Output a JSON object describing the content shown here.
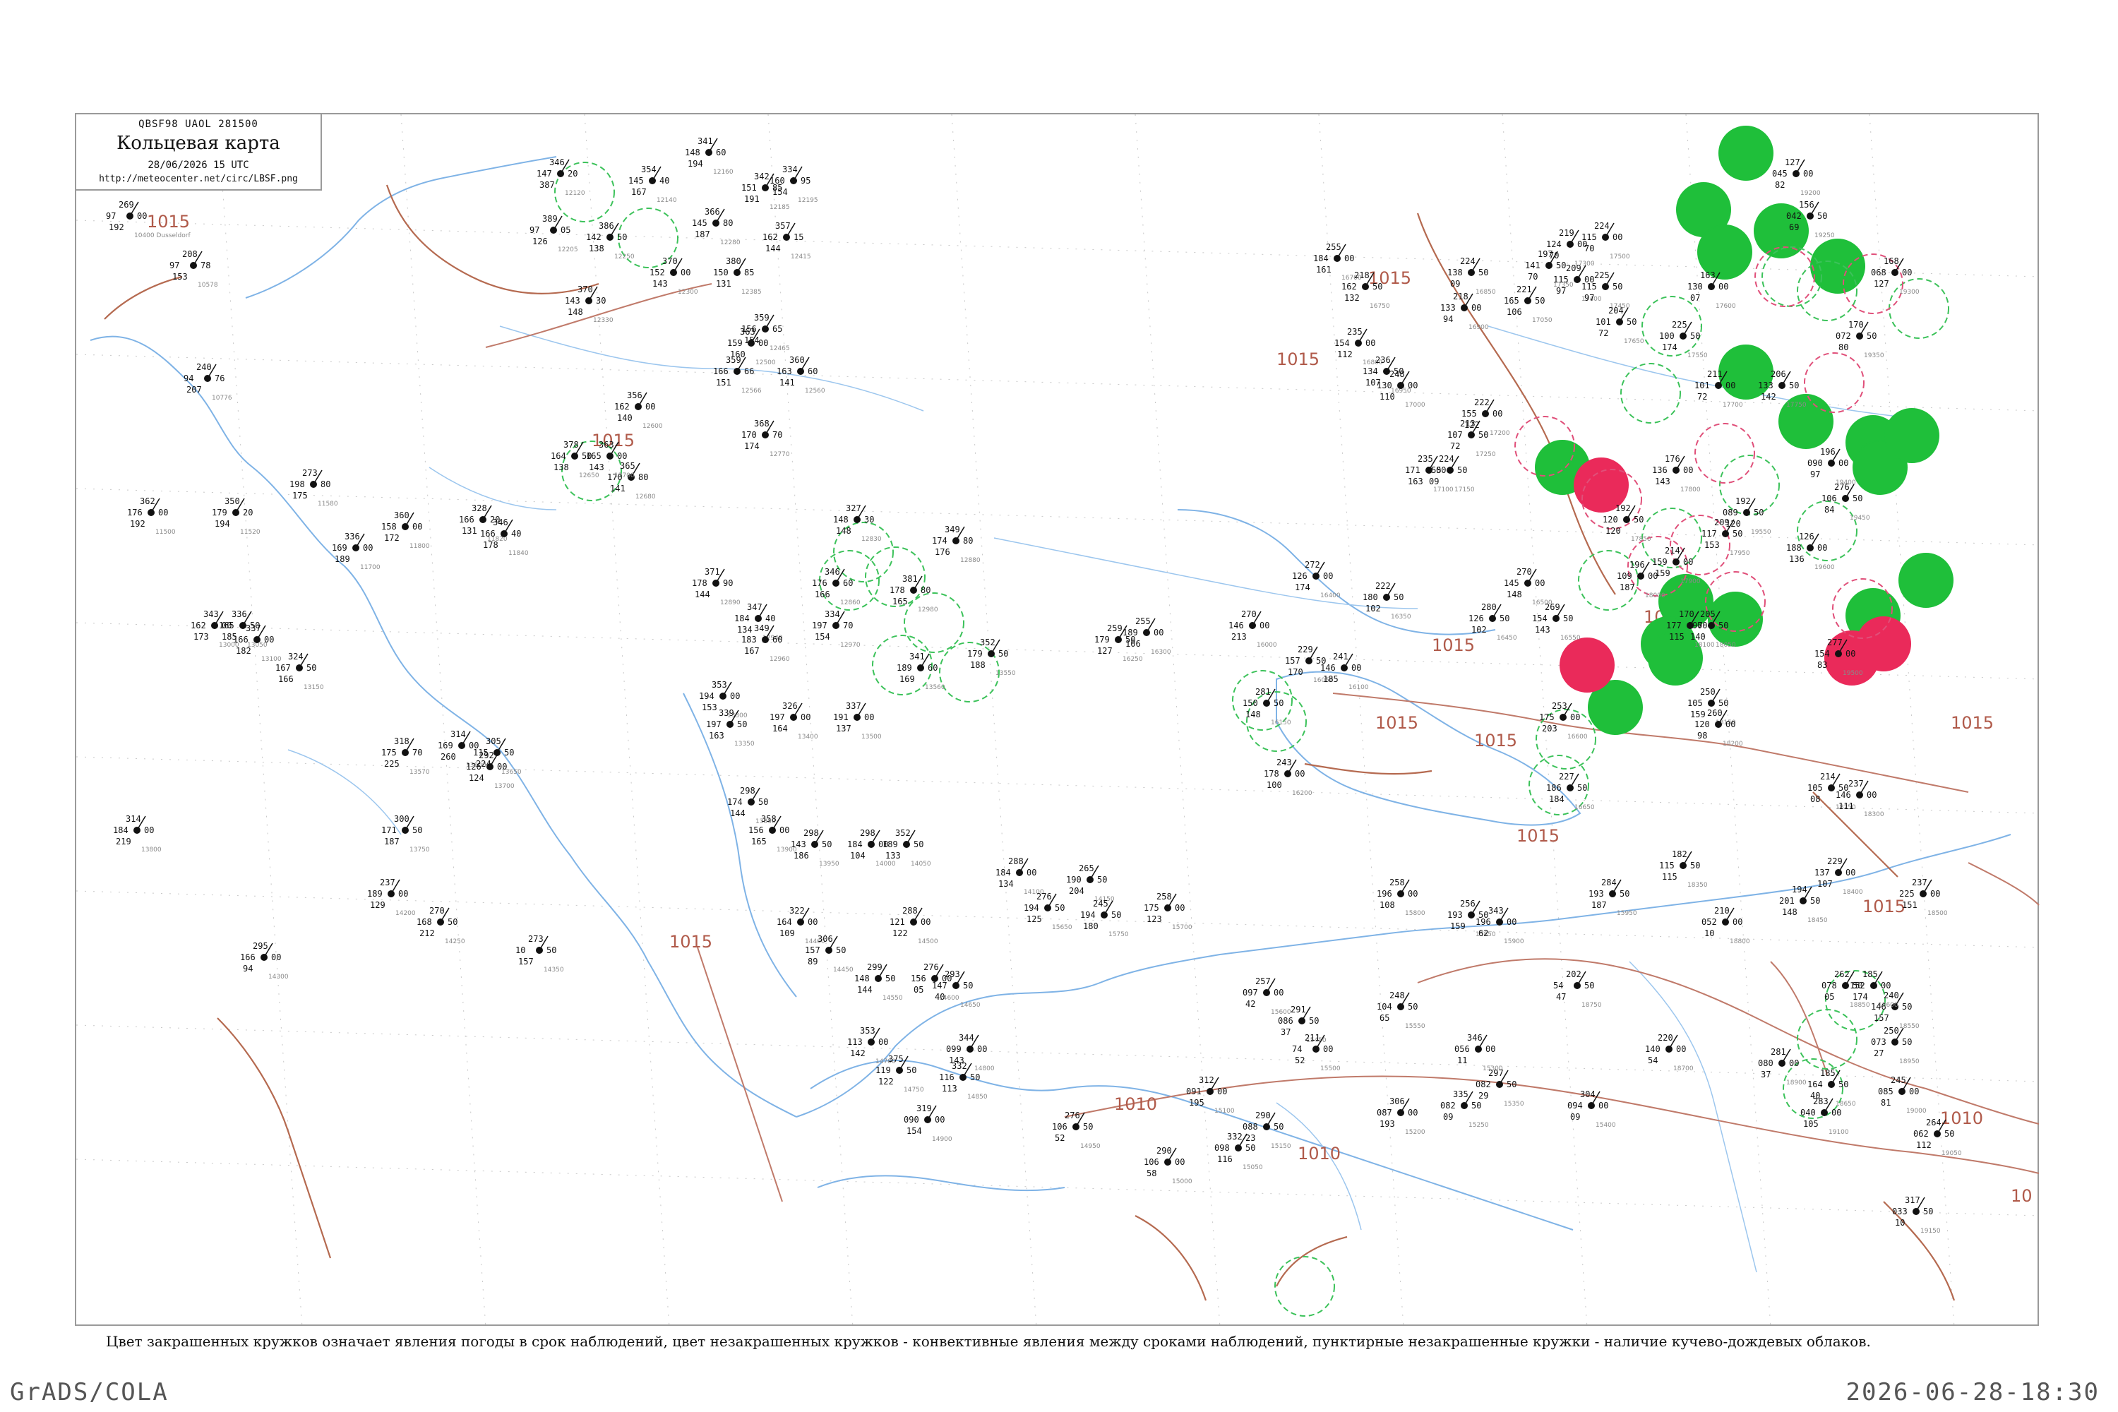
{
  "header": {
    "code": "QBSF98  UAOL  281500",
    "title": "Кольцевая карта",
    "date": "28/06/2026 15 UTC",
    "url": "http://meteocenter.net/circ/LBSF.png"
  },
  "caption": "Цвет закрашенных кружков означает явления погоды в срок наблюдений, цвет незакрашенных кружков - конвективные явления между сроками наблюдений, пунктирные незакрашенные кружки - наличие кучево-дождевых облаков.",
  "footer": {
    "left": "GrADS/COLA",
    "right": "2026-06-28-18:30"
  },
  "colors": {
    "filled_green": "#1fbf3a",
    "filled_red": "#ea2a5a",
    "ring_green": "#3cc25a",
    "ring_red": "#e0507a",
    "isobar": "#c07a6a",
    "coast": "#7fb3e6"
  },
  "isobars": [
    {
      "label": "1015"
    },
    {
      "label": "1015"
    },
    {
      "label": "1015"
    },
    {
      "label": "1015"
    },
    {
      "label": "1015"
    },
    {
      "label": "1015"
    },
    {
      "label": "1015"
    },
    {
      "label": "1015"
    },
    {
      "label": "1015"
    },
    {
      "label": "1015"
    },
    {
      "label": "1010"
    },
    {
      "label": "1010"
    },
    {
      "label": "1010"
    },
    {
      "label": "10"
    },
    {
      "label": "1015"
    },
    {
      "label": "1015"
    }
  ],
  "stations": [
    {
      "id": "10400",
      "t": "269",
      "p": "97",
      "v": "192",
      "name": "Dusseldorf"
    },
    {
      "id": "10578",
      "t": "208",
      "p": "97",
      "v": "153"
    },
    {
      "id": "10776",
      "t": "240",
      "p": "94",
      "v": "207"
    },
    {
      "id": "12120",
      "t": "346",
      "p": "147",
      "v": "387"
    },
    {
      "id": "12205",
      "t": "389",
      "p": "97",
      "v": "126"
    },
    {
      "id": "12250",
      "t": "386",
      "p": "142",
      "v": "138"
    },
    {
      "id": "12330",
      "t": "370",
      "p": "143",
      "v": "148"
    },
    {
      "id": "12140",
      "t": "354",
      "p": "145",
      "v": "167"
    },
    {
      "id": "12160",
      "t": "341",
      "p": "148",
      "v": "194"
    },
    {
      "id": "12185",
      "t": "342",
      "p": "151",
      "v": "191"
    },
    {
      "id": "12195",
      "t": "334",
      "p": "160",
      "v": "154"
    },
    {
      "id": "12280",
      "t": "366",
      "p": "145",
      "v": "187"
    },
    {
      "id": "12300",
      "t": "370",
      "p": "152",
      "v": "143"
    },
    {
      "id": "12385",
      "t": "380",
      "p": "150",
      "v": "131"
    },
    {
      "id": "12415",
      "t": "357",
      "p": "162",
      "v": "144"
    },
    {
      "id": "12465",
      "t": "359",
      "p": "156",
      "v": "154"
    },
    {
      "id": "12500",
      "t": "363",
      "p": "159",
      "v": "160"
    },
    {
      "id": "12560",
      "t": "360",
      "p": "163",
      "v": "141"
    },
    {
      "id": "12566",
      "t": "359",
      "p": "166",
      "v": "151"
    },
    {
      "id": "12600",
      "t": "356",
      "p": "162",
      "v": "140"
    },
    {
      "id": "12650",
      "t": "378",
      "p": "164",
      "v": "138"
    },
    {
      "id": "12680",
      "t": "365",
      "p": "170",
      "v": "141"
    },
    {
      "id": "12700",
      "t": "363",
      "p": "165",
      "v": "143"
    },
    {
      "id": "12770",
      "t": "368",
      "p": "170",
      "v": "174"
    },
    {
      "id": "11500",
      "t": "362",
      "p": "176",
      "v": "192"
    },
    {
      "id": "11520",
      "t": "350",
      "p": "179",
      "v": "194"
    },
    {
      "id": "11580",
      "t": "273",
      "p": "198",
      "v": "175"
    },
    {
      "id": "11700",
      "t": "336",
      "p": "169",
      "v": "189"
    },
    {
      "id": "11800",
      "t": "360",
      "p": "158",
      "v": "172"
    },
    {
      "id": "11820",
      "t": "328",
      "p": "166",
      "v": "131"
    },
    {
      "id": "11840",
      "t": "346",
      "p": "166",
      "v": "178"
    },
    {
      "id": "12830",
      "t": "327",
      "p": "148",
      "v": "148"
    },
    {
      "id": "12860",
      "t": "346",
      "p": "176",
      "v": "166"
    },
    {
      "id": "12880",
      "t": "349",
      "p": "174",
      "v": "176"
    },
    {
      "id": "12890",
      "t": "371",
      "p": "178",
      "v": "144"
    },
    {
      "id": "12940",
      "t": "347",
      "p": "184",
      "v": "134"
    },
    {
      "id": "12960",
      "t": "349",
      "p": "183",
      "v": "167"
    },
    {
      "id": "12970",
      "t": "334",
      "p": "197",
      "v": "154"
    },
    {
      "id": "12980",
      "t": "381",
      "p": "178",
      "v": "165"
    },
    {
      "id": "13000",
      "t": "343",
      "p": "162",
      "v": "173"
    },
    {
      "id": "13050",
      "t": "336",
      "p": "165",
      "v": "185"
    },
    {
      "id": "13100",
      "t": "337",
      "p": "166",
      "v": "182"
    },
    {
      "id": "13150",
      "t": "324",
      "p": "167",
      "v": "166"
    },
    {
      "id": "13300",
      "t": "353",
      "p": "194",
      "v": "153"
    },
    {
      "id": "13350",
      "t": "339",
      "p": "197",
      "v": "163"
    },
    {
      "id": "13400",
      "t": "326",
      "p": "197",
      "v": "164"
    },
    {
      "id": "13500",
      "t": "337",
      "p": "191",
      "v": "137"
    },
    {
      "id": "13550",
      "t": "352",
      "p": "179",
      "v": "188"
    },
    {
      "id": "13560",
      "t": "341",
      "p": "189",
      "v": "169"
    },
    {
      "id": "13570",
      "t": "318",
      "p": "175",
      "v": "225"
    },
    {
      "id": "13600",
      "t": "314",
      "p": "169",
      "v": "260"
    },
    {
      "id": "13650",
      "t": "305",
      "p": "115",
      "v": "224"
    },
    {
      "id": "13700",
      "t": "292",
      "p": "126",
      "v": "124"
    },
    {
      "id": "13750",
      "t": "300",
      "p": "171",
      "v": "187"
    },
    {
      "id": "13800",
      "t": "314",
      "p": "184",
      "v": "219"
    },
    {
      "id": "13850",
      "t": "298",
      "p": "174",
      "v": "144"
    },
    {
      "id": "13900",
      "t": "358",
      "p": "156",
      "v": "165"
    },
    {
      "id": "13950",
      "t": "298",
      "p": "143",
      "v": "186"
    },
    {
      "id": "14000",
      "t": "298",
      "p": "184",
      "v": "104"
    },
    {
      "id": "14050",
      "t": "352",
      "p": "189",
      "v": "133"
    },
    {
      "id": "14100",
      "t": "288",
      "p": "184",
      "v": "134"
    },
    {
      "id": "14150",
      "t": "265",
      "p": "190",
      "v": "204"
    },
    {
      "id": "14200",
      "t": "237",
      "p": "189",
      "v": "129"
    },
    {
      "id": "14250",
      "t": "270",
      "p": "168",
      "v": "212"
    },
    {
      "id": "14300",
      "t": "295",
      "p": "166",
      "v": "94"
    },
    {
      "id": "14350",
      "t": "273",
      "p": "10",
      "v": "157"
    },
    {
      "id": "14400",
      "t": "322",
      "p": "164",
      "v": "109"
    },
    {
      "id": "14450",
      "t": "306",
      "p": "157",
      "v": "89"
    },
    {
      "id": "14500",
      "t": "288",
      "p": "121",
      "v": "122"
    },
    {
      "id": "14550",
      "t": "299",
      "p": "148",
      "v": "144"
    },
    {
      "id": "14600",
      "t": "276",
      "p": "156",
      "v": "05"
    },
    {
      "id": "14650",
      "t": "293",
      "p": "147",
      "v": "40"
    },
    {
      "id": "14700",
      "t": "353",
      "p": "113",
      "v": "142"
    },
    {
      "id": "14750",
      "t": "375",
      "p": "119",
      "v": "122"
    },
    {
      "id": "14800",
      "t": "344",
      "p": "099",
      "v": "143"
    },
    {
      "id": "14850",
      "t": "332",
      "p": "116",
      "v": "113"
    },
    {
      "id": "14900",
      "t": "319",
      "p": "090",
      "v": "154"
    },
    {
      "id": "14950",
      "t": "276",
      "p": "106",
      "v": "52"
    },
    {
      "id": "15000",
      "t": "290",
      "p": "106",
      "v": "58"
    },
    {
      "id": "15050",
      "t": "332",
      "p": "098",
      "v": "116"
    },
    {
      "id": "15100",
      "t": "312",
      "p": "091",
      "v": "195"
    },
    {
      "id": "15150",
      "t": "290",
      "p": "088",
      "v": "23"
    },
    {
      "id": "15200",
      "t": "306",
      "p": "087",
      "v": "193"
    },
    {
      "id": "15250",
      "t": "335",
      "p": "082",
      "v": "09"
    },
    {
      "id": "15300",
      "t": "346",
      "p": "056",
      "v": "11"
    },
    {
      "id": "15350",
      "t": "297",
      "p": "082",
      "v": "29"
    },
    {
      "id": "15400",
      "t": "304",
      "p": "094",
      "v": "09"
    },
    {
      "id": "15450",
      "t": "291",
      "p": "086",
      "v": "37"
    },
    {
      "id": "15500",
      "t": "211",
      "p": "74",
      "v": "52"
    },
    {
      "id": "15550",
      "t": "248",
      "p": "104",
      "v": "65"
    },
    {
      "id": "15600",
      "t": "257",
      "p": "097",
      "v": "42"
    },
    {
      "id": "15650",
      "t": "276",
      "p": "194",
      "v": "125"
    },
    {
      "id": "15700",
      "t": "258",
      "p": "175",
      "v": "123"
    },
    {
      "id": "15750",
      "t": "245",
      "p": "194",
      "v": "180"
    },
    {
      "id": "15800",
      "t": "258",
      "p": "196",
      "v": "108"
    },
    {
      "id": "15850",
      "t": "256",
      "p": "193",
      "v": "159"
    },
    {
      "id": "15900",
      "t": "343",
      "p": "196",
      "v": "62"
    },
    {
      "id": "15950",
      "t": "284",
      "p": "193",
      "v": "187"
    },
    {
      "id": "16000",
      "t": "270",
      "p": "146",
      "v": "213"
    },
    {
      "id": "16050",
      "t": "229",
      "p": "157",
      "v": "170"
    },
    {
      "id": "16100",
      "t": "241",
      "p": "146",
      "v": "185"
    },
    {
      "id": "16150",
      "t": "281",
      "p": "150",
      "v": "148"
    },
    {
      "id": "16200",
      "t": "243",
      "p": "178",
      "v": "100"
    },
    {
      "id": "16250",
      "t": "259",
      "p": "179",
      "v": "127"
    },
    {
      "id": "16300",
      "t": "255",
      "p": "189",
      "v": "106"
    },
    {
      "id": "16350",
      "t": "222",
      "p": "180",
      "v": "102"
    },
    {
      "id": "16400",
      "t": "272",
      "p": "126",
      "v": "174"
    },
    {
      "id": "16450",
      "t": "280",
      "p": "126",
      "v": "102"
    },
    {
      "id": "16500",
      "t": "270",
      "p": "145",
      "v": "148"
    },
    {
      "id": "16550",
      "t": "269",
      "p": "154",
      "v": "143"
    },
    {
      "id": "16600",
      "t": "253",
      "p": "175",
      "v": "203"
    },
    {
      "id": "16650",
      "t": "227",
      "p": "186",
      "v": "184"
    },
    {
      "id": "16700",
      "t": "255",
      "p": "184",
      "v": "161"
    },
    {
      "id": "16750",
      "t": "218",
      "p": "162",
      "v": "132"
    },
    {
      "id": "16800",
      "t": "235",
      "p": "154",
      "v": "112"
    },
    {
      "id": "16850",
      "t": "224",
      "p": "138",
      "v": "09"
    },
    {
      "id": "16900",
      "t": "218",
      "p": "133",
      "v": "94"
    },
    {
      "id": "16950",
      "t": "236",
      "p": "134",
      "v": "107"
    },
    {
      "id": "17000",
      "t": "248",
      "p": "130",
      "v": "110"
    },
    {
      "id": "17050",
      "t": "221",
      "p": "165",
      "v": "106"
    },
    {
      "id": "17100",
      "t": "235",
      "p": "171",
      "v": "163"
    },
    {
      "id": "17150",
      "t": "224",
      "p": "155",
      "v": "09"
    },
    {
      "id": "17200",
      "t": "222",
      "p": "155",
      "v": "122"
    },
    {
      "id": "17250",
      "t": "213",
      "p": "107",
      "v": "72"
    },
    {
      "id": "17300",
      "t": "219",
      "p": "124",
      "v": "70"
    },
    {
      "id": "17350",
      "t": "197",
      "p": "141",
      "v": "70"
    },
    {
      "id": "17400",
      "t": "209",
      "p": "115",
      "v": "97"
    },
    {
      "id": "17450",
      "t": "225",
      "p": "115",
      "v": "97"
    },
    {
      "id": "17500",
      "t": "224",
      "p": "115",
      "v": "70"
    },
    {
      "id": "17550",
      "t": "225",
      "p": "100",
      "v": "174"
    },
    {
      "id": "17600",
      "t": "163",
      "p": "130",
      "v": "07"
    },
    {
      "id": "17650",
      "t": "204",
      "p": "101",
      "v": "72"
    },
    {
      "id": "17700",
      "t": "211",
      "p": "101",
      "v": "72"
    },
    {
      "id": "17750",
      "t": "206",
      "p": "133",
      "v": "142"
    },
    {
      "id": "17800",
      "t": "176",
      "p": "136",
      "v": "143"
    },
    {
      "id": "17850",
      "t": "192",
      "p": "120",
      "v": "120"
    },
    {
      "id": "17900",
      "t": "214",
      "p": "159",
      "v": "159"
    },
    {
      "id": "17950",
      "t": "209",
      "p": "117",
      "v": "153"
    },
    {
      "id": "18000",
      "t": "196",
      "p": "109",
      "v": "187"
    },
    {
      "id": "18050",
      "t": "205",
      "p": "097",
      "v": "140"
    },
    {
      "id": "18100",
      "t": "170",
      "p": "177",
      "v": "115"
    },
    {
      "id": "18150",
      "t": "250",
      "p": "105",
      "v": "159"
    },
    {
      "id": "18200",
      "t": "260",
      "p": "120",
      "v": "98"
    },
    {
      "id": "18250",
      "t": "214",
      "p": "105",
      "v": "08"
    },
    {
      "id": "18300",
      "t": "237",
      "p": "146",
      "v": "111"
    },
    {
      "id": "18350",
      "t": "182",
      "p": "115",
      "v": "115"
    },
    {
      "id": "18400",
      "t": "229",
      "p": "137",
      "v": "107"
    },
    {
      "id": "18450",
      "t": "194",
      "p": "201",
      "v": "148"
    },
    {
      "id": "18500",
      "t": "237",
      "p": "225",
      "v": "151"
    },
    {
      "id": "18550",
      "t": "240",
      "p": "146",
      "v": "157"
    },
    {
      "id": "18600",
      "t": "185",
      "p": "152",
      "v": "174"
    },
    {
      "id": "18650",
      "t": "185",
      "p": "164",
      "v": "40"
    },
    {
      "id": "18700",
      "t": "220",
      "p": "140",
      "v": "54"
    },
    {
      "id": "18750",
      "t": "202",
      "p": "54",
      "v": "47"
    },
    {
      "id": "18800",
      "t": "210",
      "p": "052",
      "v": "10"
    },
    {
      "id": "18850",
      "t": "262",
      "p": "078",
      "v": "05"
    },
    {
      "id": "18900",
      "t": "281",
      "p": "080",
      "v": "37"
    },
    {
      "id": "18950",
      "t": "250",
      "p": "073",
      "v": "27"
    },
    {
      "id": "19000",
      "t": "245",
      "p": "085",
      "v": "81"
    },
    {
      "id": "19050",
      "t": "264",
      "p": "062",
      "v": "112"
    },
    {
      "id": "19100",
      "t": "283",
      "p": "040",
      "v": "105"
    },
    {
      "id": "19150",
      "t": "317",
      "p": "033",
      "v": "10"
    },
    {
      "id": "19200",
      "t": "127",
      "p": "045",
      "v": "82"
    },
    {
      "id": "19250",
      "t": "156",
      "p": "042",
      "v": "69"
    },
    {
      "id": "19300",
      "t": "168",
      "p": "068",
      "v": "127"
    },
    {
      "id": "19350",
      "t": "170",
      "p": "072",
      "v": "80"
    },
    {
      "id": "19400",
      "t": "196",
      "p": "090",
      "v": "97"
    },
    {
      "id": "19450",
      "t": "276",
      "p": "106",
      "v": "84"
    },
    {
      "id": "19500",
      "t": "277",
      "p": "154",
      "v": "83"
    },
    {
      "id": "19550",
      "t": "192",
      "p": "089",
      "v": "120"
    },
    {
      "id": "19600",
      "t": "126",
      "p": "188",
      "v": "136"
    }
  ],
  "rings": [
    {
      "kind": "filled",
      "color": "green"
    },
    {
      "kind": "filled",
      "color": "green"
    },
    {
      "kind": "filled",
      "color": "green"
    },
    {
      "kind": "filled",
      "color": "green"
    },
    {
      "kind": "filled",
      "color": "green"
    },
    {
      "kind": "filled",
      "color": "green"
    },
    {
      "kind": "filled",
      "color": "green"
    },
    {
      "kind": "filled",
      "color": "green"
    },
    {
      "kind": "filled",
      "color": "green"
    },
    {
      "kind": "filled",
      "color": "green"
    },
    {
      "kind": "filled",
      "color": "green"
    },
    {
      "kind": "filled",
      "color": "green"
    },
    {
      "kind": "filled",
      "color": "green"
    },
    {
      "kind": "filled",
      "color": "green"
    },
    {
      "kind": "filled",
      "color": "green"
    },
    {
      "kind": "filled",
      "color": "green"
    },
    {
      "kind": "filled",
      "color": "green"
    },
    {
      "kind": "filled",
      "color": "green"
    },
    {
      "kind": "filled",
      "color": "red"
    },
    {
      "kind": "filled",
      "color": "red"
    },
    {
      "kind": "filled",
      "color": "red"
    },
    {
      "kind": "filled",
      "color": "red"
    },
    {
      "kind": "dashed",
      "color": "green"
    },
    {
      "kind": "dashed",
      "color": "green"
    },
    {
      "kind": "dashed",
      "color": "green"
    },
    {
      "kind": "dashed",
      "color": "green"
    },
    {
      "kind": "dashed",
      "color": "green"
    },
    {
      "kind": "dashed",
      "color": "green"
    },
    {
      "kind": "dashed",
      "color": "green"
    },
    {
      "kind": "dashed",
      "color": "green"
    },
    {
      "kind": "dashed",
      "color": "green"
    },
    {
      "kind": "dashed",
      "color": "green"
    },
    {
      "kind": "dashed",
      "color": "green"
    },
    {
      "kind": "dashed",
      "color": "green"
    },
    {
      "kind": "dashed",
      "color": "green"
    },
    {
      "kind": "dashed",
      "color": "green"
    },
    {
      "kind": "dashed",
      "color": "green"
    },
    {
      "kind": "dashed",
      "color": "green"
    },
    {
      "kind": "dashed",
      "color": "green"
    },
    {
      "kind": "dashed",
      "color": "green"
    },
    {
      "kind": "dashed",
      "color": "green"
    },
    {
      "kind": "dashed",
      "color": "green"
    },
    {
      "kind": "dashed",
      "color": "green"
    },
    {
      "kind": "dashed",
      "color": "green"
    },
    {
      "kind": "dashed",
      "color": "green"
    },
    {
      "kind": "dashed",
      "color": "green"
    },
    {
      "kind": "dashed",
      "color": "green"
    },
    {
      "kind": "dashed",
      "color": "green"
    },
    {
      "kind": "dashed",
      "color": "red"
    },
    {
      "kind": "dashed",
      "color": "red"
    },
    {
      "kind": "dashed",
      "color": "red"
    },
    {
      "kind": "dashed",
      "color": "red"
    },
    {
      "kind": "dashed",
      "color": "red"
    },
    {
      "kind": "dashed",
      "color": "red"
    },
    {
      "kind": "dashed",
      "color": "red"
    },
    {
      "kind": "dashed",
      "color": "red"
    },
    {
      "kind": "dashed",
      "color": "red"
    },
    {
      "kind": "dashed",
      "color": "red"
    }
  ]
}
